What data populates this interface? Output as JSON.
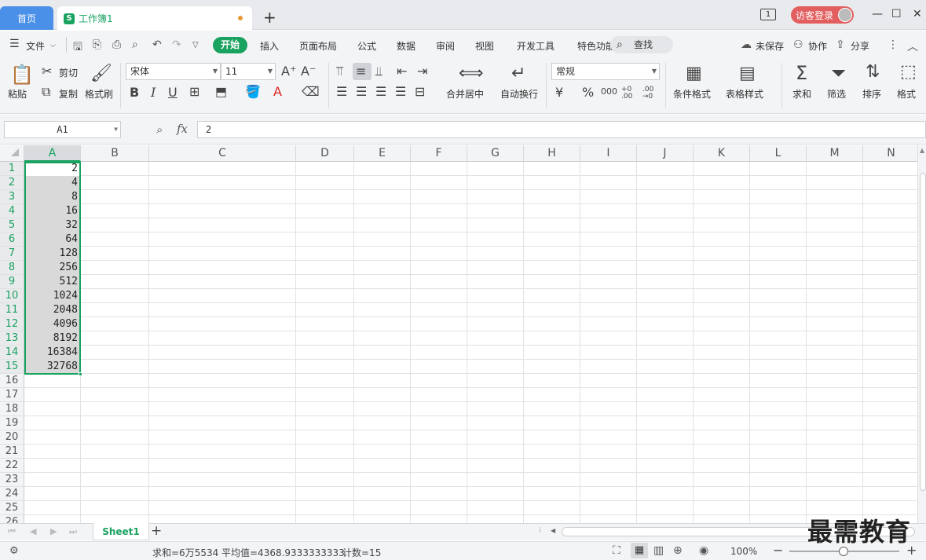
{
  "titlebar": {
    "home_tab": "首页",
    "doc_tab": "工作簿1",
    "doc_icon": "S",
    "new_tab": "+",
    "window_count": "1",
    "visitor_login": "访客登录"
  },
  "menubar": {
    "file": "文件",
    "items": [
      "开始",
      "插入",
      "页面布局",
      "公式",
      "数据",
      "审阅",
      "视图",
      "开发工具",
      "特色功能"
    ],
    "search": "查找",
    "unsaved": "未保存",
    "collab": "协作",
    "share": "分享"
  },
  "ribbon": {
    "paste": "粘贴",
    "cut": "剪切",
    "copy": "复制",
    "format_painter": "格式刷",
    "font_name": "宋体",
    "font_size": "11",
    "merge_center": "合并居中",
    "wrap_text": "自动换行",
    "number_format": "常规",
    "conditional_format": "条件格式",
    "table_style": "表格样式",
    "sum": "求和",
    "filter": "筛选",
    "sort": "排序",
    "format": "格式",
    "currency": "¥",
    "percent": "%",
    "thousands": "000",
    "increase_decimal": "+0 .00",
    "decrease_decimal": ".00 →0"
  },
  "formulabar": {
    "name_box": "A1",
    "fx": "fx",
    "value": "2"
  },
  "grid": {
    "columns": [
      "A",
      "B",
      "C",
      "D",
      "E",
      "F",
      "G",
      "H",
      "I",
      "J",
      "K",
      "L",
      "M",
      "N"
    ],
    "rows": [
      "1",
      "2",
      "3",
      "4",
      "5",
      "6",
      "7",
      "8",
      "9",
      "10",
      "11",
      "12",
      "13",
      "14",
      "15",
      "16",
      "17",
      "18",
      "19",
      "20",
      "21",
      "22",
      "23",
      "24",
      "25",
      "26"
    ],
    "column_a_values": [
      "2",
      "4",
      "8",
      "16",
      "32",
      "64",
      "128",
      "256",
      "512",
      "1024",
      "2048",
      "4096",
      "8192",
      "16384",
      "32768"
    ]
  },
  "sheets": {
    "active": "Sheet1",
    "add": "+"
  },
  "statusbar": {
    "sum": "求和=6万5534",
    "average": "平均值=4368.9333333333",
    "count": "计数=15",
    "zoom": "100%"
  },
  "watermark": "最需教育",
  "colors": {
    "accent_green": "#1aa260",
    "home_tab_blue": "#4a8fe8",
    "visitor_red": "#e35f5f"
  }
}
